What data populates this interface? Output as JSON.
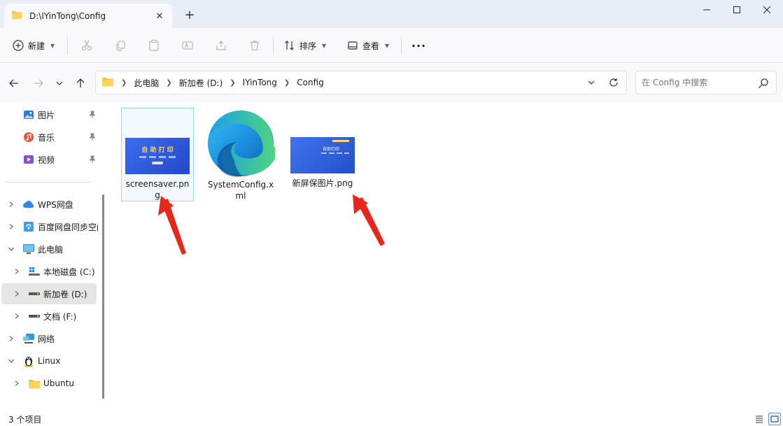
{
  "window": {
    "tab_title": "D:\\IYinTong\\Config",
    "new_tab_label": "+"
  },
  "toolbar": {
    "new_label": "新建",
    "sort_label": "排序",
    "view_label": "查看",
    "more_label": "···"
  },
  "address": {
    "breadcrumbs": [
      "此电脑",
      "新加卷 (D:)",
      "IYinTong",
      "Config"
    ],
    "search_placeholder": "在 Config 中搜索"
  },
  "sidebar": {
    "pinned": [
      {
        "label": "图片",
        "icon": "pictures-icon"
      },
      {
        "label": "音乐",
        "icon": "music-icon"
      },
      {
        "label": "视频",
        "icon": "videos-icon"
      }
    ],
    "tree": [
      {
        "label": "WPS网盘",
        "icon": "cloud-icon",
        "chevron": "right",
        "indent": 0
      },
      {
        "label": "百度网盘同步空间",
        "icon": "baidu-sync-icon",
        "chevron": "right",
        "indent": 0
      },
      {
        "label": "此电脑",
        "icon": "computer-icon",
        "chevron": "down",
        "indent": 0
      },
      {
        "label": "本地磁盘 (C:)",
        "icon": "windows-drive-icon",
        "chevron": "right",
        "indent": 1
      },
      {
        "label": "新加卷 (D:)",
        "icon": "drive-icon",
        "chevron": "right",
        "indent": 1,
        "selected": true
      },
      {
        "label": "文档 (F:)",
        "icon": "drive-icon",
        "chevron": "right",
        "indent": 1
      },
      {
        "label": "网络",
        "icon": "network-icon",
        "chevron": "right",
        "indent": 0
      },
      {
        "label": "Linux",
        "icon": "linux-penguin-icon",
        "chevron": "down",
        "indent": 0
      },
      {
        "label": "Ubuntu",
        "icon": "folder-icon",
        "chevron": "right",
        "indent": 1
      }
    ]
  },
  "files": [
    {
      "name": "screensaver.png",
      "type": "image",
      "thumb_title": "自 助 打 印",
      "selected": true
    },
    {
      "name": "SystemConfig.xml",
      "type": "xml",
      "selected": false
    },
    {
      "name": "新屏保图片.png",
      "type": "image",
      "thumb_title": "自助打印",
      "selected": false
    }
  ],
  "status": {
    "item_count": "3 个项目"
  },
  "colors": {
    "accent": "#0067c0",
    "thumb_blue": "#2a56d6",
    "annotation_arrow": "#e8261c",
    "folder_yellow": "#f5c441"
  }
}
